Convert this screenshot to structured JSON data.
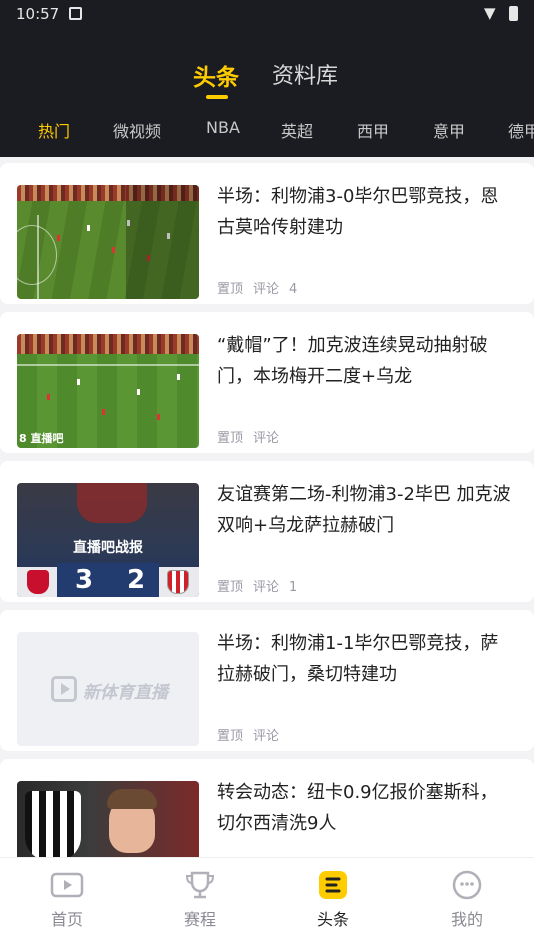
{
  "status_bar": {
    "time": "10:57"
  },
  "top_tabs": [
    {
      "label": "头条",
      "active": true
    },
    {
      "label": "资料库",
      "active": false
    }
  ],
  "categories": [
    {
      "label": "热门",
      "active": true
    },
    {
      "label": "微视频"
    },
    {
      "label": "NBA"
    },
    {
      "label": "英超"
    },
    {
      "label": "西甲"
    },
    {
      "label": "意甲"
    },
    {
      "label": "德甲"
    }
  ],
  "news": [
    {
      "title": "半场：利物浦3-0毕尔巴鄂竞技，恩古莫哈传射建功",
      "pin": "置顶",
      "comment": "评论",
      "count": "4"
    },
    {
      "title": "“戴帽”了！加克波连续晃动抽射破门，本场梅开二度+乌龙",
      "pin": "置顶",
      "comment": "评论",
      "count": ""
    },
    {
      "title": "友谊赛第二场-利物浦3-2毕巴 加克波双响+乌龙萨拉赫破门",
      "pin": "置顶",
      "comment": "评论",
      "count": "1"
    },
    {
      "title": "半场：利物浦1-1毕尔巴鄂竞技，萨拉赫破门，桑切特建功",
      "pin": "置顶",
      "comment": "评论",
      "count": ""
    },
    {
      "title": "转会动态：纽卡0.9亿报价塞斯科，切尔西清洗9人",
      "pin": "",
      "comment": "",
      "count": ""
    }
  ],
  "thumbs": {
    "watermark": "8 直播吧",
    "score_title": "直播吧战报",
    "score_home": "3",
    "score_away": "2",
    "placeholder_brand": "新体育直播"
  },
  "bottom_nav": [
    {
      "label": "首页",
      "icon": "video-play-icon",
      "active": false
    },
    {
      "label": "赛程",
      "icon": "trophy-icon",
      "active": false
    },
    {
      "label": "头条",
      "icon": "headline-icon",
      "active": true
    },
    {
      "label": "我的",
      "icon": "smiley-face-icon",
      "active": false
    }
  ],
  "colors": {
    "accent": "#ffcc00",
    "header_bg": "#1b1c21",
    "meta_text": "#9a9aa5"
  }
}
